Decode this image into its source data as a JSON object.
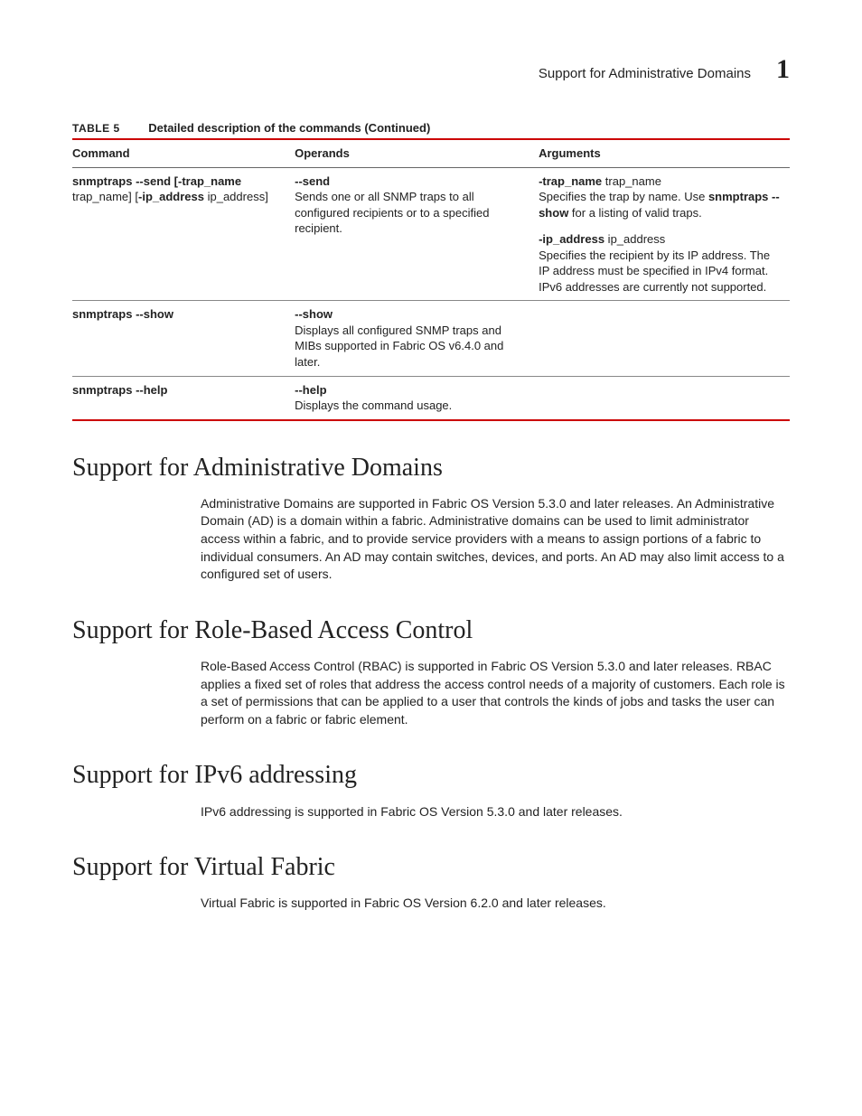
{
  "header": {
    "running_title": "Support for Administrative Domains",
    "chapter_number": "1"
  },
  "table": {
    "label": "TABLE 5",
    "caption": "Detailed description of the commands (Continued)",
    "columns": [
      "Command",
      "Operands",
      "Arguments"
    ],
    "rows": [
      {
        "command_bold1": "snmptraps --send [-trap_name",
        "command_plain1": " trap_name] [",
        "command_bold2": "-ip_address",
        "command_plain2": " ip_address]",
        "operand_bold": "--send",
        "operand_text": "Sends one or all SNMP traps to all configured recipients or to a specified recipient.",
        "arguments": [
          {
            "tag_bold": "-trap_name",
            "tag_plain": " trap_name",
            "desc_pre": "Specifies the trap by name. Use ",
            "desc_bold": "snmptraps --show",
            "desc_post": " for a listing of valid traps."
          },
          {
            "tag_bold": "-ip_address",
            "tag_plain": " ip_address",
            "desc_pre": "Specifies the recipient by its IP address. The IP address must be specified in IPv4 format. IPv6 addresses are currently not supported.",
            "desc_bold": "",
            "desc_post": ""
          }
        ]
      },
      {
        "command_bold1": "snmptraps --show",
        "command_plain1": "",
        "command_bold2": "",
        "command_plain2": "",
        "operand_bold": "--show",
        "operand_text": "Displays all configured SNMP traps and MIBs supported in Fabric OS v6.4.0 and later.",
        "arguments": []
      },
      {
        "command_bold1": "snmptraps --help",
        "command_plain1": "",
        "command_bold2": "",
        "command_plain2": "",
        "operand_bold": "--help",
        "operand_text": "Displays the command usage.",
        "arguments": []
      }
    ]
  },
  "sections": [
    {
      "heading": "Support for Administrative Domains",
      "body": "Administrative Domains are supported in Fabric OS Version 5.3.0 and later releases. An Administrative Domain (AD) is a domain within a fabric. Administrative domains can be used to limit administrator access within a fabric, and to provide service providers with a means to assign portions of a fabric to individual consumers. An AD may contain switches, devices, and ports. An AD may also limit access to a configured set of users."
    },
    {
      "heading": "Support for Role-Based Access Control",
      "body": "Role-Based Access Control (RBAC) is supported in Fabric OS Version 5.3.0 and later releases. RBAC applies a fixed set of roles that address the access control needs of a majority of customers. Each role is a set of permissions that can be applied to a user that controls the kinds of jobs and tasks the user can perform on a fabric or fabric element."
    },
    {
      "heading": "Support for IPv6 addressing",
      "body": "IPv6 addressing is supported in Fabric OS Version 5.3.0 and later releases."
    },
    {
      "heading": "Support for Virtual Fabric",
      "body": "Virtual Fabric is supported in Fabric OS Version 6.2.0 and later releases."
    }
  ]
}
